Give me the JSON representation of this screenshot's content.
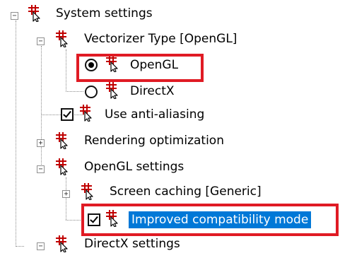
{
  "tree": {
    "system_settings": "System settings",
    "vectorizer_type": "Vectorizer Type [OpenGL]",
    "opengl": "OpenGL",
    "directx": "DirectX",
    "anti_aliasing": "Use anti-aliasing",
    "rendering_optimization": "Rendering optimization",
    "opengl_settings": "OpenGL settings",
    "screen_caching": "Screen caching [Generic]",
    "improved_compat": "Improved compatibility mode",
    "directx_settings": "DirectX settings"
  },
  "state": {
    "vectorizer_selected": "OpenGL",
    "anti_aliasing_checked": true,
    "improved_compat_checked": true,
    "selected_item": "Improved compatibility mode"
  },
  "colors": {
    "highlight_border": "#e01b24",
    "selection_bg": "#0078d7",
    "icon_red": "#c00000"
  }
}
